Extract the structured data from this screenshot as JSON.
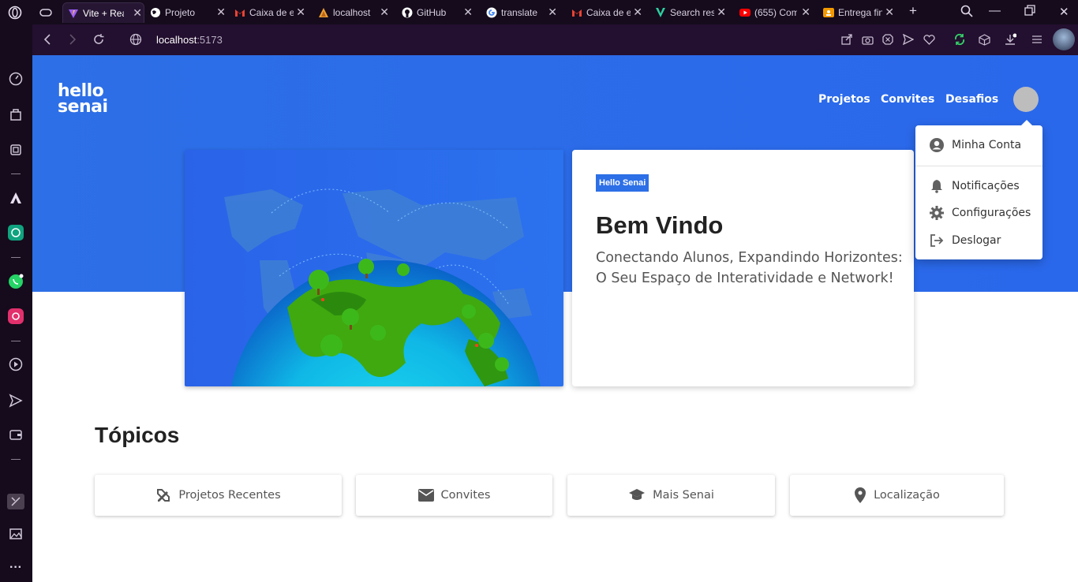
{
  "browser": {
    "tabs": [
      {
        "label": "Vite + React",
        "icon": "vite-icon",
        "color": "#9b5cff"
      },
      {
        "label": "Projeto",
        "icon": "globe-icon",
        "color": "#ffffff"
      },
      {
        "label": "Caixa de entrada",
        "icon": "gmail-icon",
        "color": "#ea4335"
      },
      {
        "label": "localhost",
        "icon": "localhost-icon",
        "color": "#f0a030"
      },
      {
        "label": "GitHub",
        "icon": "github-icon",
        "color": "#ffffff"
      },
      {
        "label": "translate",
        "icon": "google-icon",
        "color": "#4285f4"
      },
      {
        "label": "Caixa de entrada",
        "icon": "gmail-icon",
        "color": "#ea4335"
      },
      {
        "label": "Search results",
        "icon": "v-icon",
        "color": "#2ecfa0"
      },
      {
        "label": "(655) Com",
        "icon": "youtube-icon",
        "color": "#ff0000"
      },
      {
        "label": "Entrega final",
        "icon": "classroom-icon",
        "color": "#f29900"
      }
    ],
    "url_host": "localhost",
    "url_port": ":5173"
  },
  "site": {
    "logo_line1": "hello",
    "logo_line2": "senai",
    "nav": [
      "Projetos",
      "Convites",
      "Desafios"
    ]
  },
  "menu": {
    "items": [
      "Minha Conta",
      "Notificações",
      "Configurações",
      "Deslogar"
    ]
  },
  "welcome": {
    "badge": "Hello Senai",
    "title": "Bem Vindo",
    "subtitle": "Conectando Alunos, Expandindo Horizontes: O Seu Espaço de Interatividade e Network!"
  },
  "topics": {
    "title": "Tópicos",
    "items": [
      "Projetos Recentes",
      "Convites",
      "Mais Senai",
      "Localização"
    ]
  },
  "colors": {
    "brand": "#2d6fe6",
    "browser_bg": "#150b1c",
    "addressbar_bg": "#230f2f"
  }
}
